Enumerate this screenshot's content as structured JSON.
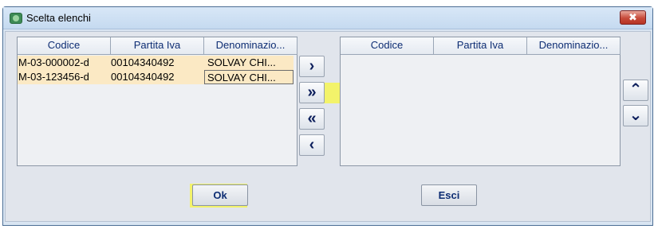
{
  "window": {
    "title": "Scelta elenchi",
    "close_glyph": "✖"
  },
  "left_table": {
    "columns": [
      "Codice",
      "Partita Iva",
      "Denominazio..."
    ],
    "rows": [
      [
        "M-03-000002-d",
        "00104340492",
        "SOLVAY CHI..."
      ],
      [
        "M-03-123456-d",
        "00104340492",
        "SOLVAY CHI..."
      ]
    ]
  },
  "right_table": {
    "columns": [
      "Codice",
      "Partita Iva",
      "Denominazio..."
    ],
    "rows": []
  },
  "transfer_buttons": {
    "move_one_right": "›",
    "move_all_right": "»",
    "move_all_left": "«",
    "move_one_left": "‹"
  },
  "order_buttons": {
    "move_up": "⌃",
    "move_down": "⌄"
  },
  "footer": {
    "ok_label": "Ok",
    "exit_label": "Esci"
  },
  "highlight_color": "#f3f36a"
}
